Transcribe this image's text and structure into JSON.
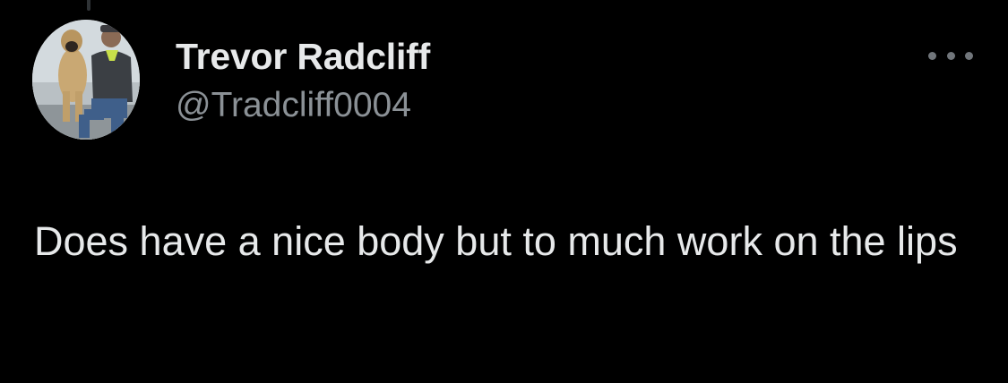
{
  "tweet": {
    "author": {
      "display_name": "Trevor Radcliff",
      "handle": "@Tradcliff0004",
      "avatar_icon": "profile-photo-man-with-dog"
    },
    "more_icon": "more-horizontal-icon",
    "text": "Does have a nice body but to much work on the lips"
  },
  "colors": {
    "background": "#000000",
    "primary_text": "#e7e9ea",
    "secondary_text": "#8b9196",
    "icon": "#71767b"
  }
}
